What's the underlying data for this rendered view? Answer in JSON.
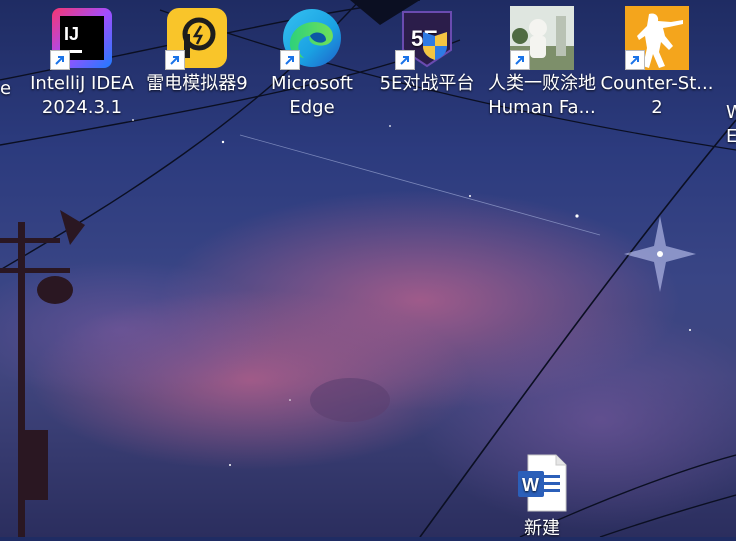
{
  "desktop": {
    "icons": [
      {
        "name": "partial-left",
        "label": "e"
      },
      {
        "name": "intellij",
        "label": "IntelliJ IDEA\n2024.3.1",
        "badge": "IJ"
      },
      {
        "name": "ldplayer",
        "label": "雷电模拟器9"
      },
      {
        "name": "edge",
        "label": "Microsoft\nEdge"
      },
      {
        "name": "5e",
        "label": "5E对战平台",
        "badge": "5E"
      },
      {
        "name": "human-fall-flat",
        "label": "人类一败涂地\nHuman Fa..."
      },
      {
        "name": "counter-strike",
        "label": "Counter-St...\n2"
      },
      {
        "name": "partial-right",
        "label": "W\nE"
      },
      {
        "name": "word-doc",
        "label": "新建",
        "badge": "W"
      }
    ]
  },
  "colors": {
    "sky_top": "#1f2c63",
    "sky_bottom": "#2b2e5e",
    "cloud_pink": "#b85f86",
    "intellij": "#f7366f",
    "ldplayer": "#f9c52a",
    "edge": "#1aa1e2",
    "cs2": "#f4a51c",
    "word": "#2b5fb9"
  }
}
